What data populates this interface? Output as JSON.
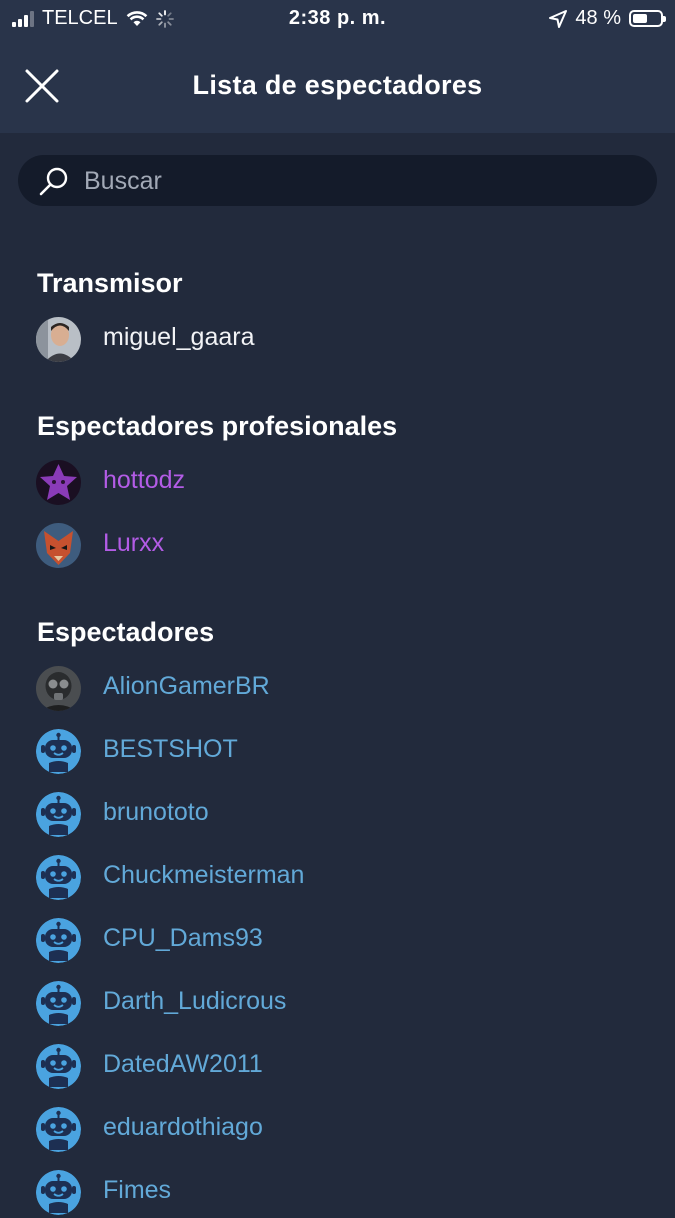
{
  "status_bar": {
    "carrier": "TELCEL",
    "time": "2:38 p. m.",
    "battery": "48 %"
  },
  "header": {
    "title": "Lista de espectadores"
  },
  "search": {
    "placeholder": "Buscar"
  },
  "sections": {
    "broadcaster": {
      "title": "Transmisor",
      "users": [
        "miguel_gaara"
      ]
    },
    "pro_viewers": {
      "title": "Espectadores profesionales",
      "users": [
        "hottodz",
        "Lurxx"
      ]
    },
    "viewers": {
      "title": "Espectadores",
      "users": [
        "AlionGamerBR",
        "BESTSHOT",
        "brunototo",
        "Chuckmeisterman",
        "CPU_Dams93",
        "Darth_Ludicrous",
        "DatedAW2011",
        "eduardothiago",
        "Fimes"
      ]
    }
  },
  "colors": {
    "background": "#222a3c",
    "header": "#29344a",
    "pro_name": "#b35ce6",
    "viewer_name": "#62a9d8"
  }
}
